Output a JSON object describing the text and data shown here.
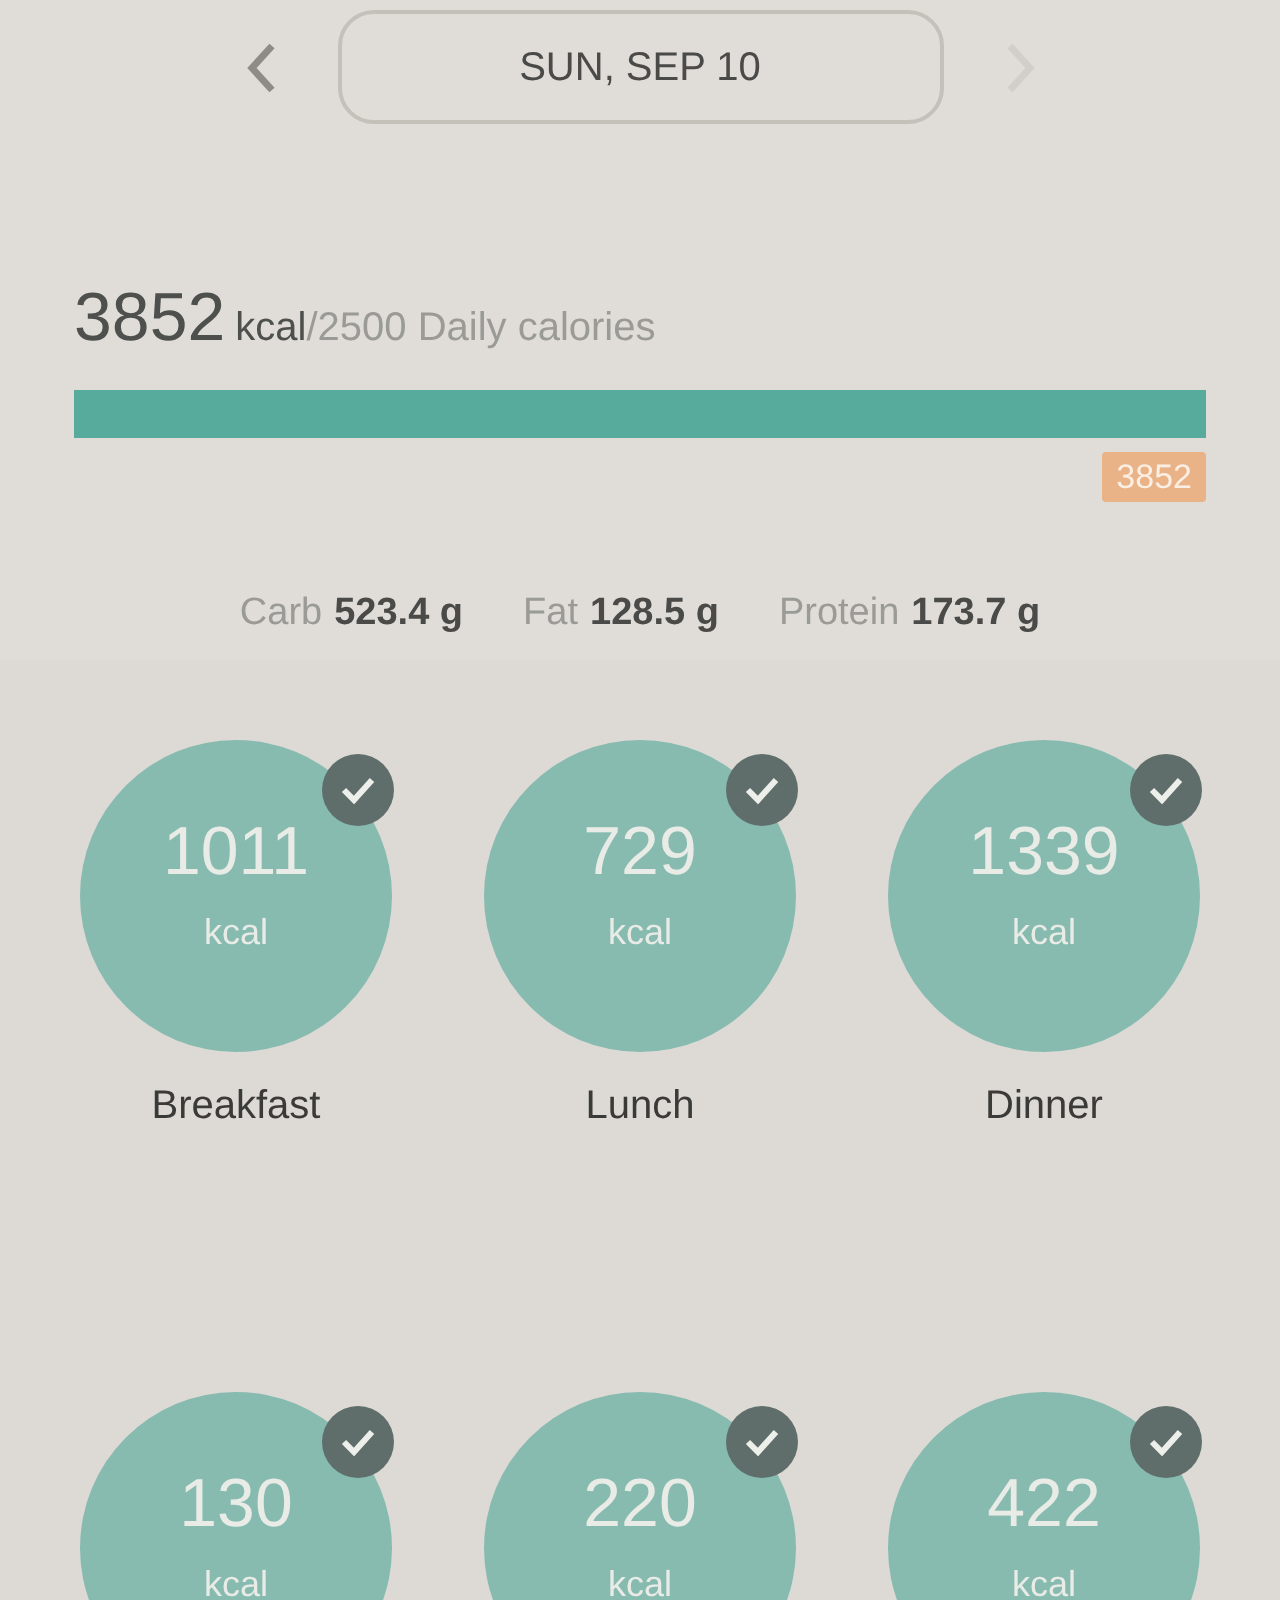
{
  "date_nav": {
    "title": "SUN, SEP 10",
    "prev_disabled": false,
    "next_disabled": true
  },
  "summary": {
    "total": "3852",
    "unit": "kcal",
    "goal": "/2500 Daily calories",
    "level": 1,
    "marker": "3852"
  },
  "macros": [
    {
      "label": "Carb",
      "value": "523.4 g"
    },
    {
      "label": "Fat",
      "value": "128.5 g"
    },
    {
      "label": "Protein",
      "value": "173.7 g"
    }
  ],
  "meals": [
    {
      "calories": "1011",
      "unit": "kcal",
      "name": "Breakfast",
      "checked": true
    },
    {
      "calories": "729",
      "unit": "kcal",
      "name": "Lunch",
      "checked": true
    },
    {
      "calories": "1339",
      "unit": "kcal",
      "name": "Dinner",
      "checked": true
    },
    {
      "calories": "130",
      "unit": "kcal",
      "checked": true
    },
    {
      "calories": "220",
      "unit": "kcal",
      "checked": true
    },
    {
      "calories": "422",
      "unit": "kcal",
      "checked": true
    }
  ]
}
